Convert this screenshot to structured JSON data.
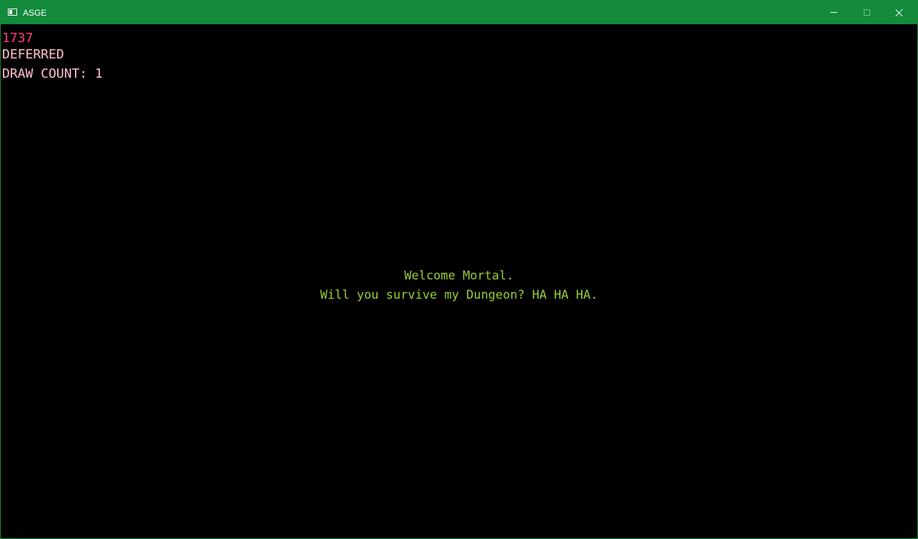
{
  "window": {
    "title": "ASGE",
    "title_bar_color": "#138a3c",
    "icons": {
      "app": "app-window-icon",
      "minimize": "minimize-icon",
      "maximize": "maximize-icon",
      "close": "close-icon"
    }
  },
  "hud": {
    "fps": "1737",
    "fps_color": "#ff3d7f",
    "render_mode": "DEFERRED",
    "render_mode_color": "#ffc0cb",
    "draw_count": "DRAW COUNT: 1",
    "draw_count_color": "#ffc0cb"
  },
  "message": {
    "line1": "Welcome Mortal.",
    "line2": "Will you survive my Dungeon? HA HA HA.",
    "color": "#9acd32"
  },
  "background_color": "#000000"
}
